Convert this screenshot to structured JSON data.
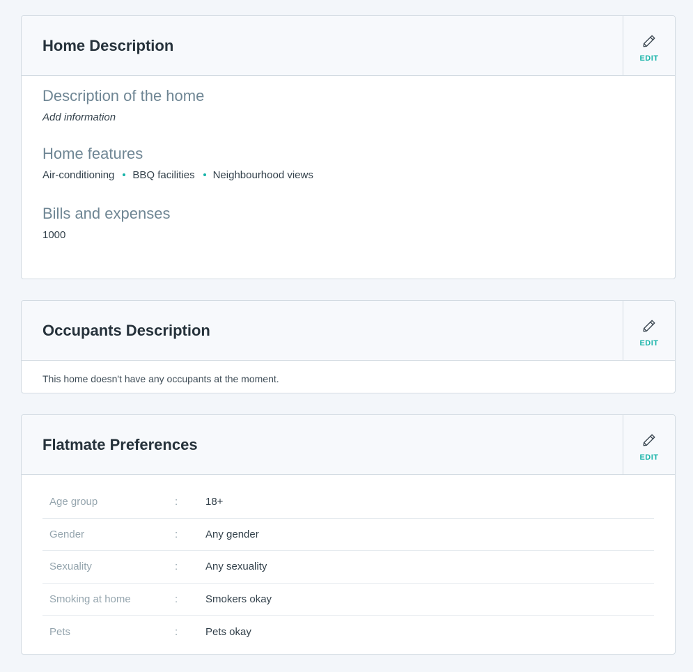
{
  "home_card": {
    "title": "Home Description",
    "edit_label": "EDIT",
    "sections": [
      {
        "heading": "Description of the home",
        "value": "Add information"
      },
      {
        "heading": "Home features",
        "features": [
          "Air-conditioning",
          "BBQ facilities",
          "Neighbourhood views"
        ]
      },
      {
        "heading": "Bills and expenses",
        "value": "1000"
      }
    ]
  },
  "occupants_card": {
    "title": "Occupants Description",
    "edit_label": "EDIT",
    "message": "This home doesn't have any occupants at the moment."
  },
  "flatmate_card": {
    "title": "Flatmate Preferences",
    "edit_label": "EDIT",
    "separator": ":",
    "rows": [
      {
        "label": "Age group",
        "value": "18+"
      },
      {
        "label": "Gender",
        "value": "Any gender"
      },
      {
        "label": "Sexuality",
        "value": "Any sexuality"
      },
      {
        "label": "Smoking at home",
        "value": "Smokers okay"
      },
      {
        "label": "Pets",
        "value": "Pets okay"
      }
    ]
  },
  "icons": {
    "edit": "pencil-icon"
  },
  "colors": {
    "accent": "#16b3a8",
    "heading_muted": "#6f8694",
    "label_muted": "#95a5ae"
  }
}
